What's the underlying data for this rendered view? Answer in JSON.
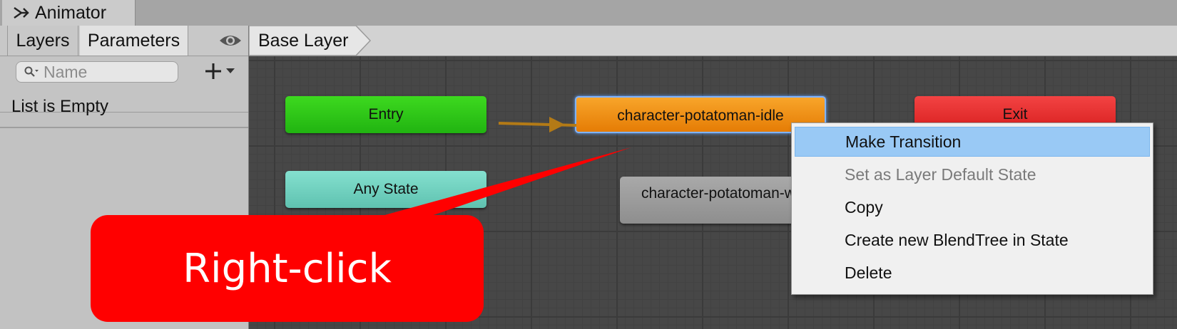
{
  "window": {
    "tab_label": "Animator",
    "tab_icon": "animator-icon"
  },
  "left_panel": {
    "tabs": [
      {
        "label": "Layers",
        "selected": false
      },
      {
        "label": "Parameters",
        "selected": true
      }
    ],
    "visibility_icon": "eye-icon",
    "search": {
      "placeholder": "Name",
      "value": "",
      "icon": "search-icon"
    },
    "add_icon": "plus-dropdown-icon",
    "empty_message": "List is Empty"
  },
  "breadcrumb": {
    "items": [
      "Base Layer"
    ]
  },
  "graph": {
    "nodes": {
      "entry": {
        "label": "Entry",
        "color": "#21b411"
      },
      "idle": {
        "label": "character-potatoman-idle",
        "color": "#e57c05",
        "selected": true
      },
      "exit": {
        "label": "Exit",
        "color": "#d61d1d"
      },
      "any_state": {
        "label": "Any State",
        "color": "#5fc2b0"
      },
      "state2": {
        "label": "character-potatoman-walk",
        "color": "#8e8e8e"
      }
    }
  },
  "annotation": {
    "label": "Right-click",
    "color": "#ff0000"
  },
  "context_menu": {
    "items": [
      {
        "label": "Make Transition",
        "state": "highlighted"
      },
      {
        "label": "Set as Layer Default State",
        "state": "disabled"
      },
      {
        "label": "Copy",
        "state": "normal"
      },
      {
        "label": "Create new BlendTree in State",
        "state": "normal"
      },
      {
        "label": "Delete",
        "state": "normal"
      }
    ]
  }
}
